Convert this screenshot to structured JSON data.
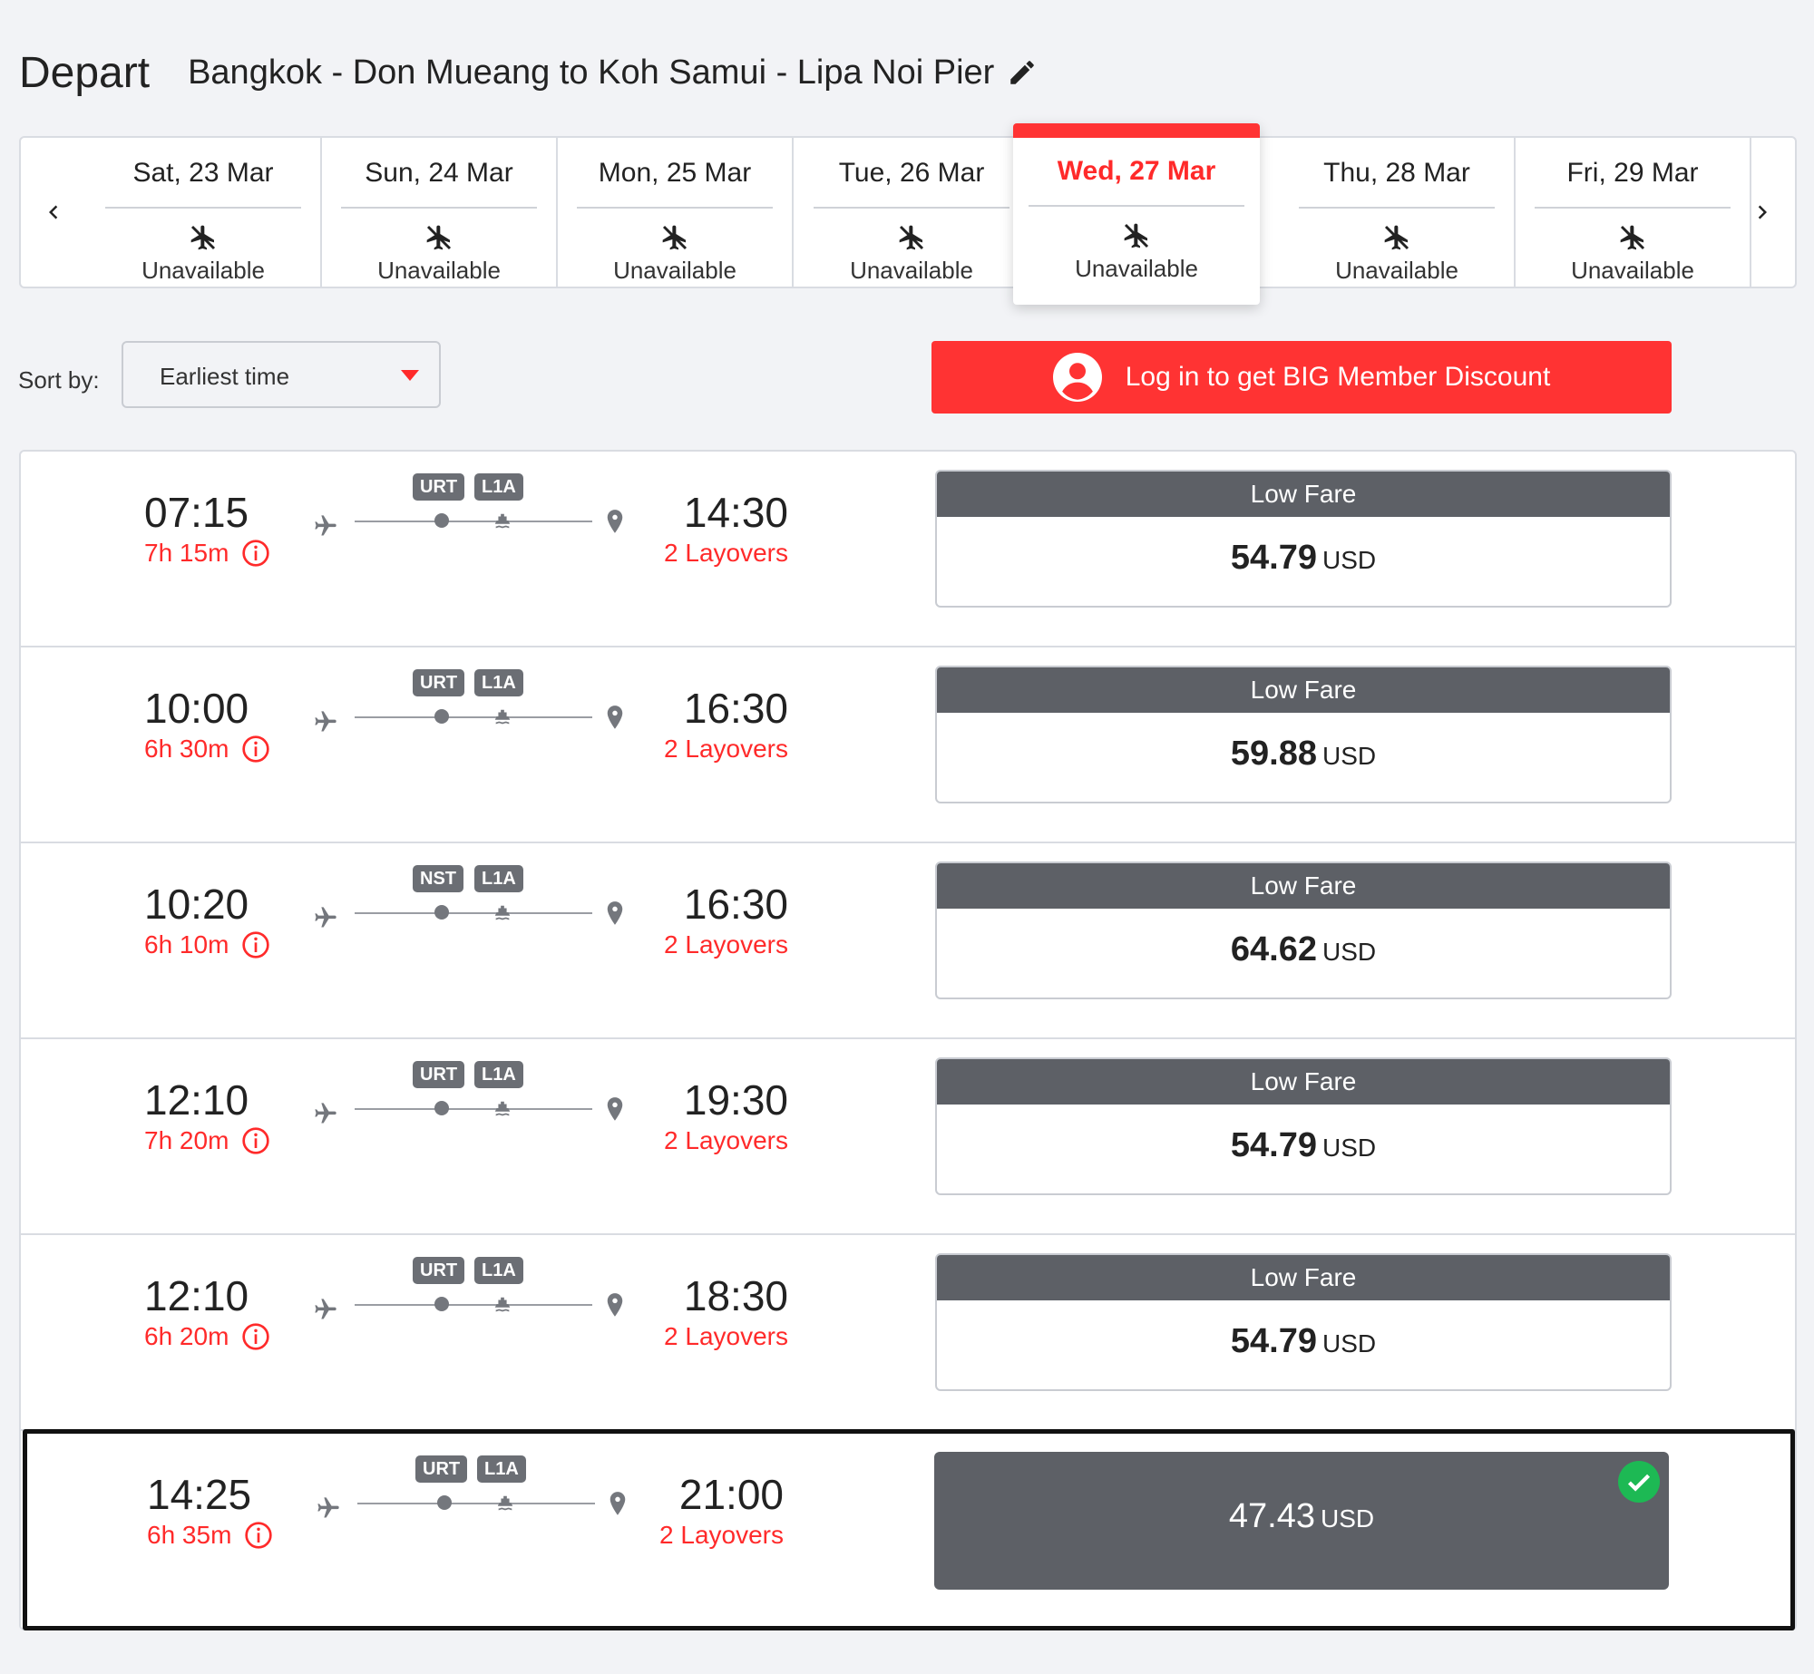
{
  "header": {
    "title": "Depart",
    "route": "Bangkok - Don Mueang to Koh Samui - Lipa Noi Pier",
    "edit_icon": "pencil-icon"
  },
  "dates": [
    {
      "label": "Sat, 23 Mar",
      "status": "Unavailable"
    },
    {
      "label": "Sun, 24 Mar",
      "status": "Unavailable"
    },
    {
      "label": "Mon, 25 Mar",
      "status": "Unavailable"
    },
    {
      "label": "Tue, 26 Mar",
      "status": "Unavailable"
    },
    {
      "label": "Wed, 27 Mar",
      "status": "Unavailable",
      "selected": true
    },
    {
      "label": "Thu, 28 Mar",
      "status": "Unavailable"
    },
    {
      "label": "Fri, 29 Mar",
      "status": "Unavailable"
    }
  ],
  "sort": {
    "label": "Sort by:",
    "value": "Earliest time"
  },
  "login": {
    "label": "Log in to get BIG Member Discount"
  },
  "colors": {
    "accent": "#ff3333",
    "fare_header": "#5d6066"
  },
  "flights": [
    {
      "dep": "07:15",
      "duration": "7h 15m",
      "stop1": "URT",
      "stop2": "L1A",
      "arr": "14:30",
      "layovers": "2 Layovers",
      "fare_label": "Low Fare",
      "price": "54.79",
      "currency": "USD"
    },
    {
      "dep": "10:00",
      "duration": "6h 30m",
      "stop1": "URT",
      "stop2": "L1A",
      "arr": "16:30",
      "layovers": "2 Layovers",
      "fare_label": "Low Fare",
      "price": "59.88",
      "currency": "USD"
    },
    {
      "dep": "10:20",
      "duration": "6h 10m",
      "stop1": "NST",
      "stop2": "L1A",
      "arr": "16:30",
      "layovers": "2 Layovers",
      "fare_label": "Low Fare",
      "price": "64.62",
      "currency": "USD"
    },
    {
      "dep": "12:10",
      "duration": "7h 20m",
      "stop1": "URT",
      "stop2": "L1A",
      "arr": "19:30",
      "layovers": "2 Layovers",
      "fare_label": "Low Fare",
      "price": "54.79",
      "currency": "USD"
    },
    {
      "dep": "12:10",
      "duration": "6h 20m",
      "stop1": "URT",
      "stop2": "L1A",
      "arr": "18:30",
      "layovers": "2 Layovers",
      "fare_label": "Low Fare",
      "price": "54.79",
      "currency": "USD"
    },
    {
      "dep": "14:25",
      "duration": "6h 35m",
      "stop1": "URT",
      "stop2": "L1A",
      "arr": "21:00",
      "layovers": "2 Layovers",
      "price": "47.43",
      "currency": "USD",
      "selected": true
    }
  ]
}
